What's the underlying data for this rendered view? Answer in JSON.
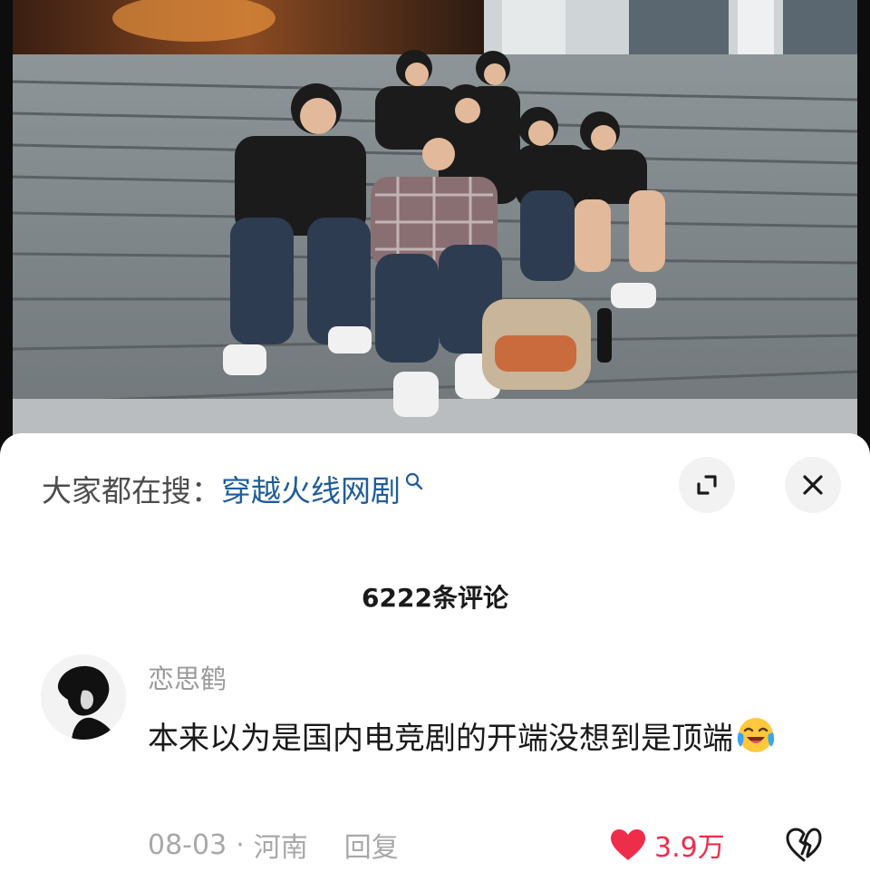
{
  "search": {
    "prefix": "大家都在搜：",
    "term": "穿越火线网剧"
  },
  "icons": {
    "search": "search-icon",
    "expand": "expand-icon",
    "close": "close-icon",
    "like": "heart-icon",
    "dislike": "broken-heart-icon",
    "emoji": "laughing-crying-emoji"
  },
  "comments_header": {
    "count_label": "6222条评论"
  },
  "comment": {
    "username": "恋思鹤",
    "text": "本来以为是国内电竞剧的开端没想到是顶端",
    "date": "08-03",
    "separator": "·",
    "location": "河南",
    "reply_label": "回复",
    "like_count": "3.9万"
  },
  "colors": {
    "accent_link": "#1f5d99",
    "like_red": "#ee2d4b",
    "muted_text": "#a8a8a8"
  }
}
